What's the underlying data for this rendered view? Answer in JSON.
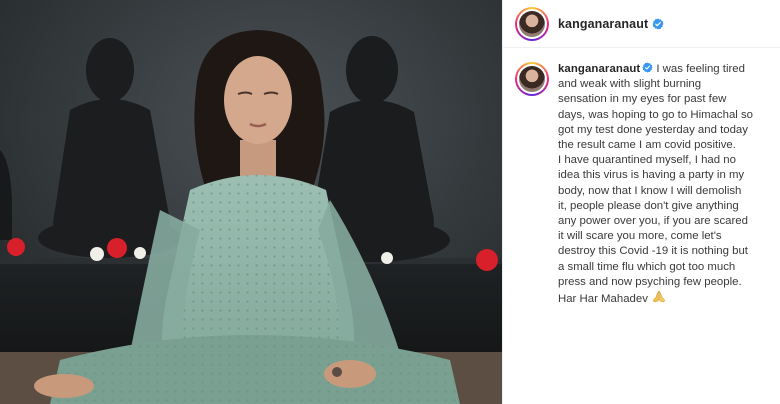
{
  "post": {
    "account": {
      "username": "kanganaranaut",
      "verified": true,
      "verified_badge_color": "#3897f0"
    },
    "caption": {
      "username": "kanganaranaut",
      "lines": [
        "I was feeling tired",
        "and weak with slight burning",
        "sensation in my eyes for past few",
        "days, was hoping to go to Himachal so",
        "got my test done yesterday and today",
        "the result came I am covid positive.",
        "I have quarantined myself, I had no",
        "idea this virus is having a party in my",
        "body, now that I know I will demolish",
        "it, people please don't give anything",
        "any power over you, if you are scared",
        "it will scare you more, come let's",
        "destroy this Covid -19 it is nothing but",
        "a small time flu which got too much",
        "press and now psyching few people.",
        "Har Har Mahadev"
      ],
      "emoji": "praying-hands-icon"
    },
    "media": {
      "subject": "photo",
      "accent_colors": {
        "kurta": "#8fb2a6",
        "flowers": "#d8202a",
        "wall": "#34393b"
      }
    }
  }
}
